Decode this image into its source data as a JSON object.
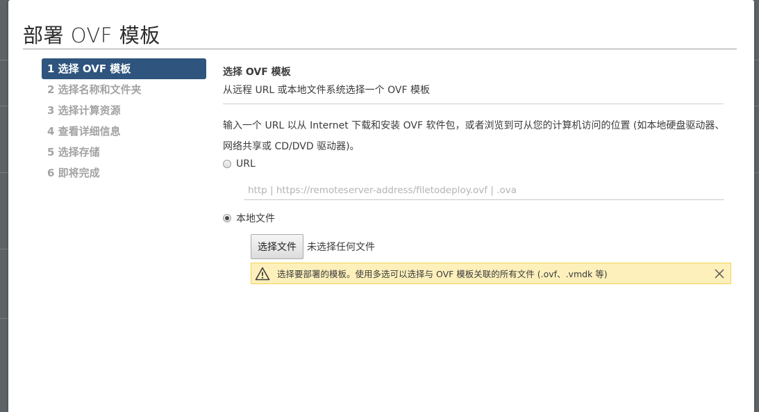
{
  "dialog": {
    "title": "部署 OVF 模板"
  },
  "wizard": {
    "steps": [
      {
        "label": "1 选择 OVF 模板",
        "active": true
      },
      {
        "label": "2 选择名称和文件夹",
        "active": false
      },
      {
        "label": "3 选择计算资源",
        "active": false
      },
      {
        "label": "4 查看详细信息",
        "active": false
      },
      {
        "label": "5 选择存储",
        "active": false
      },
      {
        "label": "6 即将完成",
        "active": false
      }
    ]
  },
  "step": {
    "title": "选择 OVF 模板",
    "subtitle": "从远程 URL 或本地文件系统选择一个 OVF 模板",
    "description": "输入一个 URL 以从 Internet 下载和安装 OVF 软件包，或者浏览到可从您的计算机访问的位置 (如本地硬盘驱动器、网络共享或 CD/DVD 驱动器)。"
  },
  "source": {
    "url_option_label": "URL",
    "url_option_selected": false,
    "url_placeholder": "http | https://remoteserver-address/filetodeploy.ovf | .ova",
    "url_value": "",
    "local_option_label": "本地文件",
    "local_option_selected": true,
    "choose_file_label": "选择文件",
    "file_status": "未选择任何文件"
  },
  "warning": {
    "icon": "warning-triangle-icon",
    "text": "选择要部署的模板。使用多选可以选择与 OVF 模板关联的所有文件 (.ovf、.vmdk 等)",
    "close_icon": "close-icon"
  },
  "colors": {
    "active_step_bg": "#2f557e",
    "inactive_step_text": "#a3a3a3",
    "warning_bg": "#fdf0bb",
    "warning_border": "#f1d354",
    "backdrop": "#5e6367"
  }
}
